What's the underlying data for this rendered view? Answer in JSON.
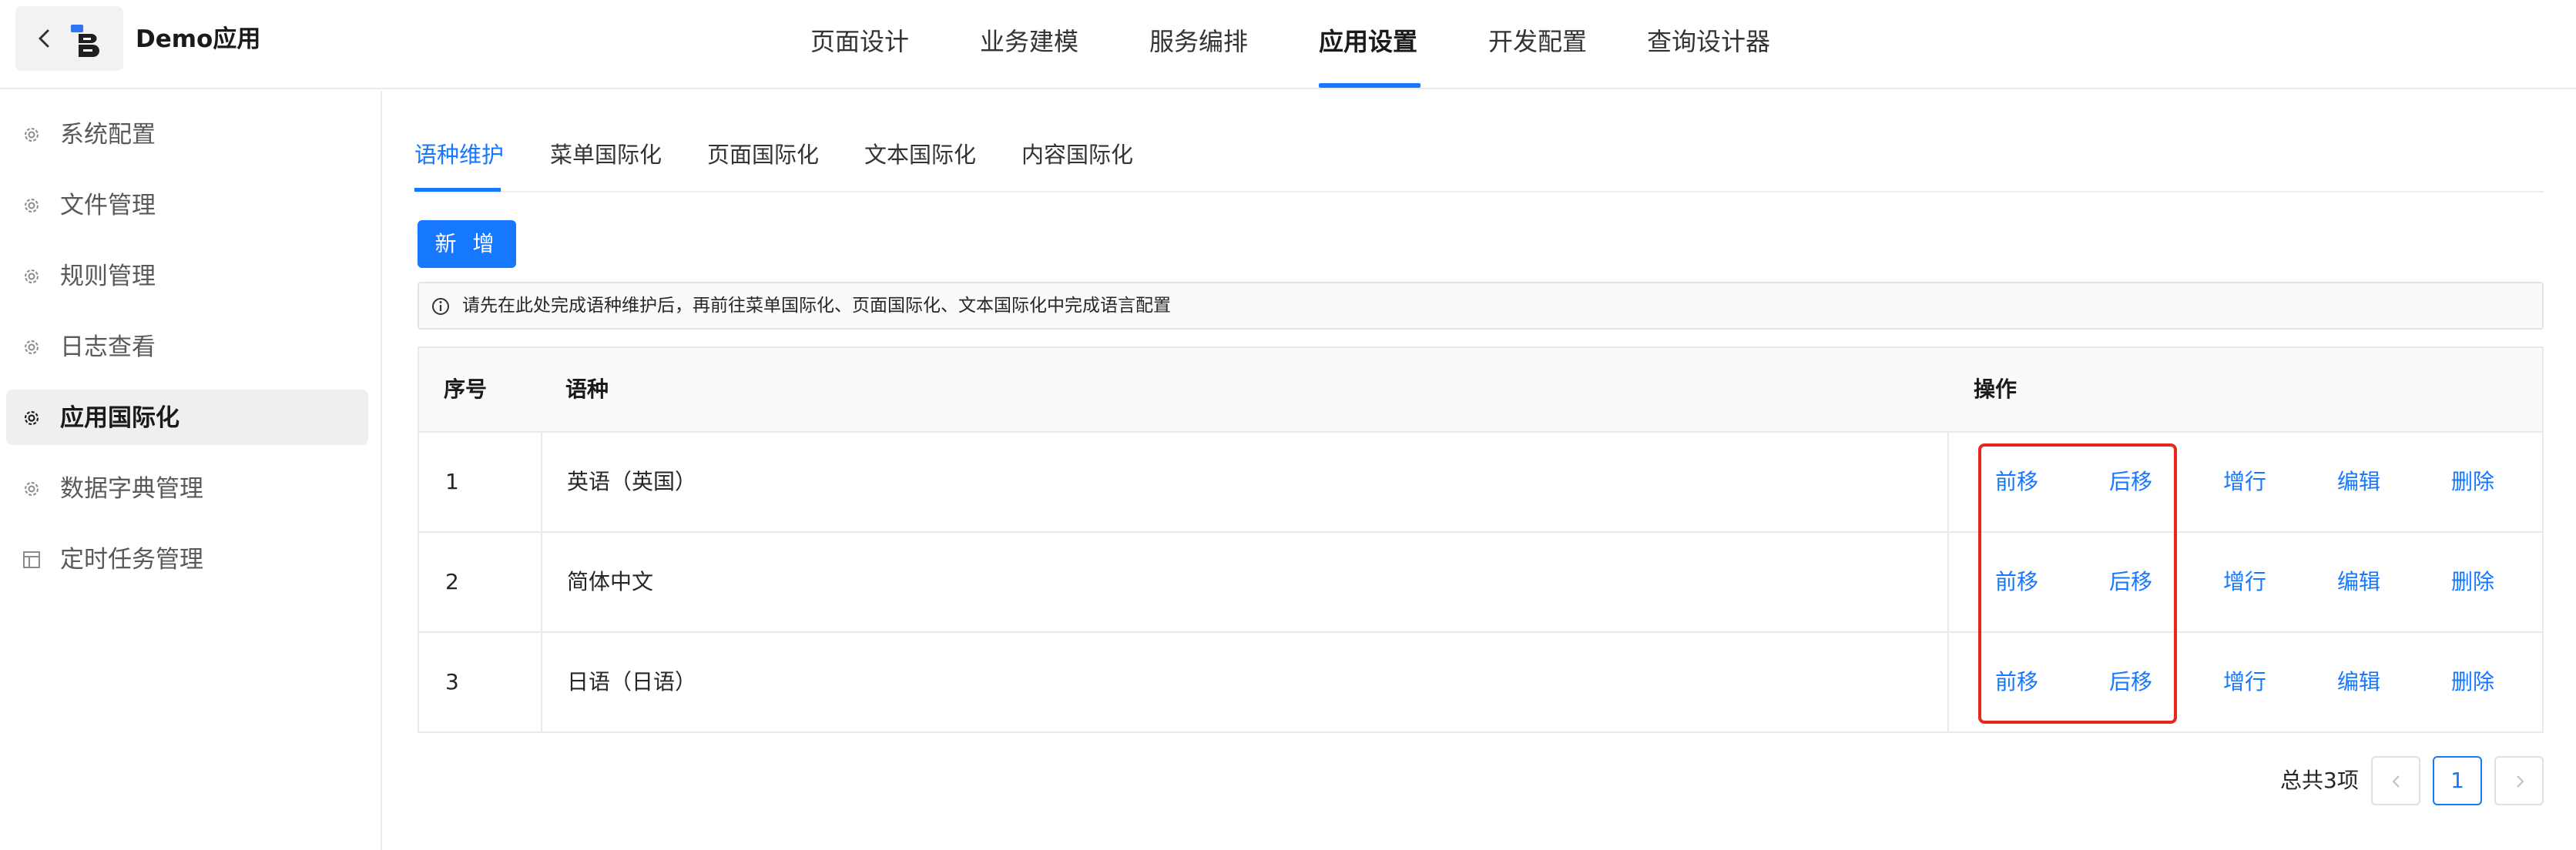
{
  "header": {
    "app_name": "Demo应用",
    "nav": [
      {
        "label": "页面设计",
        "active": false
      },
      {
        "label": "业务建模",
        "active": false
      },
      {
        "label": "服务编排",
        "active": false
      },
      {
        "label": "应用设置",
        "active": true
      },
      {
        "label": "开发配置",
        "active": false
      },
      {
        "label": "查询设计器",
        "active": false
      }
    ]
  },
  "sidebar": {
    "items": [
      {
        "label": "系统配置",
        "icon": "gear-icon",
        "active": false
      },
      {
        "label": "文件管理",
        "icon": "gear-icon",
        "active": false
      },
      {
        "label": "规则管理",
        "icon": "gear-icon",
        "active": false
      },
      {
        "label": "日志查看",
        "icon": "gear-icon",
        "active": false
      },
      {
        "label": "应用国际化",
        "icon": "gear-icon",
        "active": true
      },
      {
        "label": "数据字典管理",
        "icon": "gear-icon",
        "active": false
      },
      {
        "label": "定时任务管理",
        "icon": "table-icon",
        "active": false
      }
    ]
  },
  "tabs": [
    {
      "label": "语种维护",
      "active": true
    },
    {
      "label": "菜单国际化",
      "active": false
    },
    {
      "label": "页面国际化",
      "active": false
    },
    {
      "label": "文本国际化",
      "active": false
    },
    {
      "label": "内容国际化",
      "active": false
    }
  ],
  "toolbar": {
    "add_label": "新 增"
  },
  "notice": {
    "text": "请先在此处完成语种维护后，再前往菜单国际化、页面国际化、文本国际化中完成语言配置"
  },
  "table": {
    "headers": {
      "index": "序号",
      "language": "语种",
      "actions": "操作"
    },
    "rows": [
      {
        "index": "1",
        "language": "英语（英国）"
      },
      {
        "index": "2",
        "language": "简体中文"
      },
      {
        "index": "3",
        "language": "日语（日语）"
      }
    ],
    "actions": [
      "前移",
      "后移",
      "增行",
      "编辑",
      "删除"
    ]
  },
  "pagination": {
    "total": "总共3项",
    "current_page": "1"
  },
  "colors": {
    "accent": "#1677ff",
    "highlight": "#e8261e"
  }
}
